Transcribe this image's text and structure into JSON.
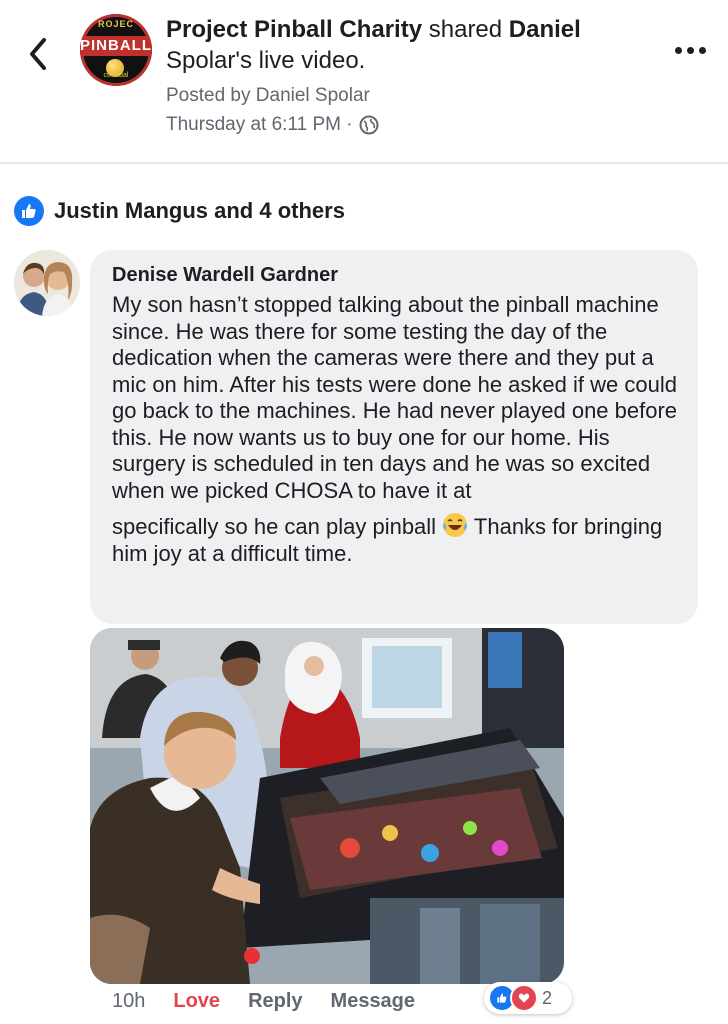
{
  "header": {
    "page_name": "Project Pinball Charity",
    "shared_text": " shared ",
    "person": "Daniel",
    "post_tail": "Spolar's live video.",
    "logo_top": "ROJEC",
    "logo_mid": "PINBALL",
    "logo_bottom": "ctPinbal",
    "posted_by": "Posted by Daniel Spolar",
    "timestamp": "Thursday at 6:11 PM ·"
  },
  "reactions": {
    "summary": "Justin Mangus and 4 others",
    "icon": "like-icon"
  },
  "comment": {
    "author": "Denise Wardell Gardner",
    "text": "My son hasn’t stopped talking about the pinball machine since. He was there for some testing the day of the dedication when the cameras were there and they put a mic on him. After his tests were done he asked if we could go back to the machines. He had never played one before this. He now wants us to buy one for our home. His surgery is scheduled in ten days and he was so excited when we picked CHOSA to have it at",
    "text_tail_before": "specifically so he can play pinball ",
    "text_tail_after": " Thanks for bringing him joy at a difficult time.",
    "emoji": "laughing-tears-emoji",
    "time_ago": "10h",
    "love_label": "Love",
    "reply_label": "Reply",
    "message_label": "Message",
    "reaction_count": "2"
  },
  "colors": {
    "brand_blue": "#1877f2",
    "love_red": "#e4444f",
    "bubble_bg": "#eff0f2",
    "meta_gray": "#606770"
  }
}
